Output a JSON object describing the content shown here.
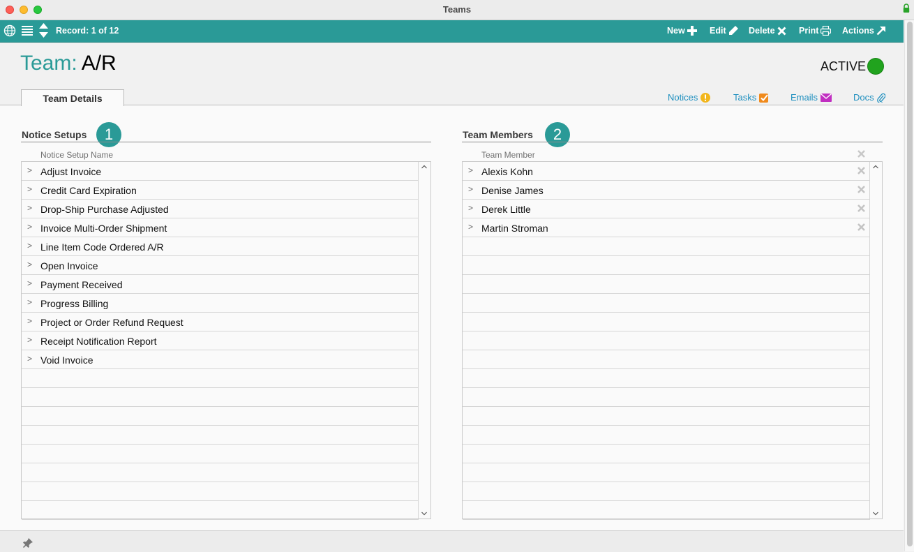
{
  "window": {
    "title": "Teams"
  },
  "toolbar": {
    "record": "Record: 1 of 12",
    "new_label": "New",
    "edit_label": "Edit",
    "delete_label": "Delete",
    "print_label": "Print",
    "actions_label": "Actions"
  },
  "header": {
    "label": "Team:",
    "value": "A/R",
    "status": "ACTIVE",
    "status_color": "#21a31e"
  },
  "tabs": [
    {
      "label": "Team Details",
      "active": true
    }
  ],
  "links": {
    "notices": "Notices",
    "tasks": "Tasks",
    "emails": "Emails",
    "docs": "Docs"
  },
  "notice_setups": {
    "title": "Notice Setups",
    "badge": "1",
    "column": "Notice Setup Name",
    "items": [
      "Adjust Invoice",
      "Credit Card Expiration",
      "Drop-Ship Purchase Adjusted",
      "Invoice Multi-Order Shipment",
      "Line Item Code Ordered A/R",
      "Open Invoice",
      "Payment Received",
      "Progress Billing",
      "Project or Order Refund Request",
      "Receipt Notification Report",
      "Void Invoice"
    ]
  },
  "team_members": {
    "title": "Team Members",
    "badge": "2",
    "column": "Team Member",
    "items": [
      "Alexis Kohn",
      "Denise James",
      "Derek Little",
      "Martin Stroman"
    ]
  },
  "colors": {
    "accent": "#2a9a97",
    "link": "#1e8fbf",
    "notices_icon": "#f2b61c",
    "tasks_icon": "#f08a1c",
    "emails_icon": "#c12fc1"
  }
}
